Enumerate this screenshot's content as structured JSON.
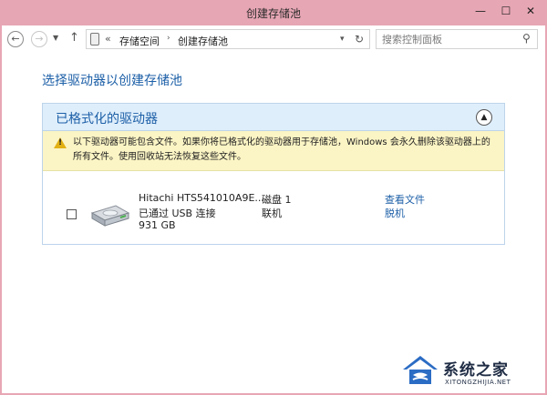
{
  "window": {
    "title": "创建存储池",
    "controls": {
      "minimize": "—",
      "maximize": "☐",
      "close": "✕"
    }
  },
  "nav": {
    "back_icon": "back-arrow-icon",
    "forward_icon": "forward-arrow-icon",
    "up_icon": "up-arrow-icon",
    "breadcrumb": [
      "存储空间",
      "创建存储池"
    ],
    "breadcrumb_prefix": "«",
    "search": {
      "placeholder": "搜索控制面板"
    }
  },
  "content": {
    "heading": "选择驱动器以创建存储池",
    "panel": {
      "title": "已格式化的驱动器",
      "warning": "以下驱动器可能包含文件。如果你将已格式化的驱动器用于存储池，Windows 会永久删除该驱动器上的所有文件。使用回收站无法恢复这些文件。",
      "drives": [
        {
          "checked": false,
          "name": "Hitachi HTS541010A9E...",
          "connection": "已通过 USB 连接",
          "size": "931 GB",
          "disk": "磁盘 1",
          "status": "联机",
          "link_view": "查看文件",
          "link_offline": "脱机"
        }
      ]
    }
  },
  "watermark": {
    "name": "系统之家",
    "url": "XITONGZHIJIA.NET"
  },
  "colors": {
    "title_bar": "#e7a6b4",
    "accent_text": "#1c5fa7",
    "panel_header": "#dfeefb",
    "warning_bg": "#fbf4c4"
  }
}
